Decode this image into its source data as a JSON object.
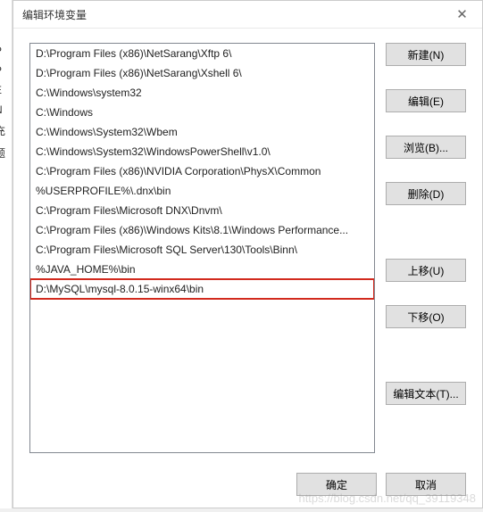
{
  "bg_fragments": [
    "d",
    "",
    "P",
    "P",
    "E",
    "N",
    "",
    "",
    "充",
    "题",
    "",
    "",
    "d"
  ],
  "dialog": {
    "title": "编辑环境变量"
  },
  "list": {
    "items": [
      "D:\\Program Files (x86)\\NetSarang\\Xftp 6\\",
      "D:\\Program Files (x86)\\NetSarang\\Xshell 6\\",
      "C:\\Windows\\system32",
      "C:\\Windows",
      "C:\\Windows\\System32\\Wbem",
      "C:\\Windows\\System32\\WindowsPowerShell\\v1.0\\",
      "C:\\Program Files (x86)\\NVIDIA Corporation\\PhysX\\Common",
      "%USERPROFILE%\\.dnx\\bin",
      "C:\\Program Files\\Microsoft DNX\\Dnvm\\",
      "C:\\Program Files (x86)\\Windows Kits\\8.1\\Windows Performance...",
      "C:\\Program Files\\Microsoft SQL Server\\130\\Tools\\Binn\\",
      "%JAVA_HOME%\\bin",
      "D:\\MySQL\\mysql-8.0.15-winx64\\bin"
    ],
    "highlighted_index": 12
  },
  "buttons": {
    "new": "新建(N)",
    "edit": "编辑(E)",
    "browse": "浏览(B)...",
    "delete": "删除(D)",
    "move_up": "上移(U)",
    "move_down": "下移(O)",
    "edit_text": "编辑文本(T)...",
    "ok": "确定",
    "cancel": "取消"
  },
  "watermark": "https://blog.csdn.net/qq_39119348"
}
